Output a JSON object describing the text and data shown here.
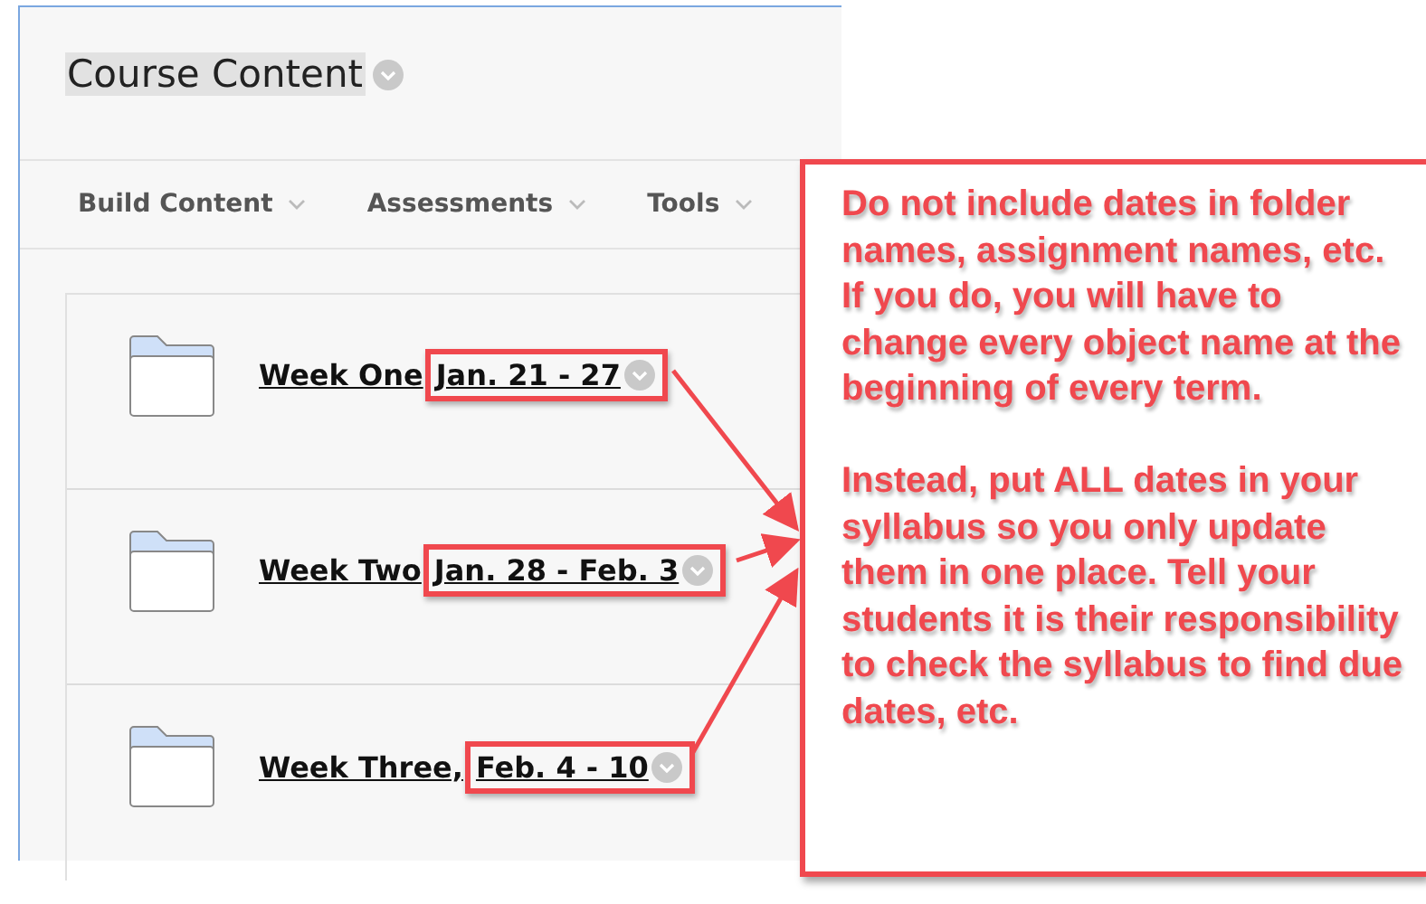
{
  "page": {
    "title": "Course Content"
  },
  "toolbar": [
    {
      "label": "Build Content"
    },
    {
      "label": "Assessments"
    },
    {
      "label": "Tools"
    }
  ],
  "items": [
    {
      "title": "Week One",
      "date": "Jan. 21 - 27"
    },
    {
      "title": "Week Two",
      "date": "Jan. 28 - Feb. 3"
    },
    {
      "title": "Week Three,",
      "date": "Feb. 4 - 10"
    }
  ],
  "callout": {
    "paragraphs": [
      "Do not include dates in folder names, assignment names, etc. If you do, you will have to change every object name at the beginning of every term.",
      "Instead, put ALL dates in your syllabus so you only update them in one place. Tell your students it is their responsibility to check the syllabus to find due dates, etc."
    ]
  }
}
